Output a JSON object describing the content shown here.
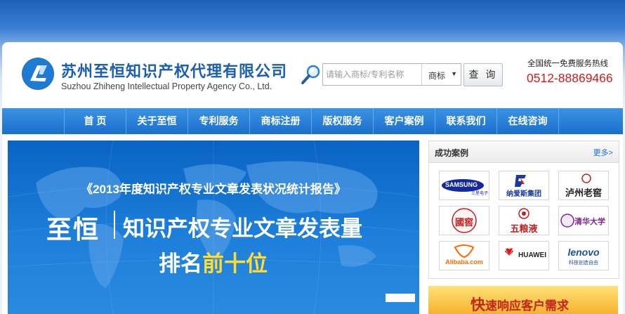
{
  "company": {
    "name_cn": "苏州至恒知识产权代理有限公司",
    "name_en": "Suzhou Zhiheng Intellectual Property Agency Co., Ltd."
  },
  "search": {
    "placeholder": "请输入商标/专利名称",
    "select_value": "商标",
    "button_label": "查 询"
  },
  "hotline": {
    "label": "全国统一免费服务热线",
    "number": "0512-88869466"
  },
  "nav": {
    "items": [
      {
        "label": "首 页"
      },
      {
        "label": "关于至恒"
      },
      {
        "label": "专利服务"
      },
      {
        "label": "商标注册"
      },
      {
        "label": "版权服务"
      },
      {
        "label": "客户案例"
      },
      {
        "label": "联系我们"
      },
      {
        "label": "在线咨询"
      }
    ]
  },
  "banner": {
    "headline": "《2013年度知识产权专业文章发表状况统计报告》",
    "brand": "至恒",
    "main": "知识产权专业文章发表量",
    "rank_prefix": "排名",
    "rank_highlight": "前十位"
  },
  "cases": {
    "title": "成功案例",
    "more": "更多>",
    "logos": [
      {
        "name": "SAMSUNG",
        "sub": "三星电子"
      },
      {
        "name": "纳爱斯集团"
      },
      {
        "name": "泸州老窖"
      },
      {
        "name": "國窖"
      },
      {
        "name": "五粮液"
      },
      {
        "name": "清华大学"
      },
      {
        "name": "Alibaba.com"
      },
      {
        "name": "HUAWEI"
      },
      {
        "name": "lenovo",
        "sub": "科技创造自由"
      }
    ]
  },
  "promo": {
    "big_char": "快",
    "rest": "速响应客户需求"
  },
  "colors": {
    "brand_blue": "#1b5fb3",
    "nav_blue": "#1a6fcc",
    "hotline_red": "#d51a1a",
    "highlight_yellow": "#ffdc2d"
  }
}
